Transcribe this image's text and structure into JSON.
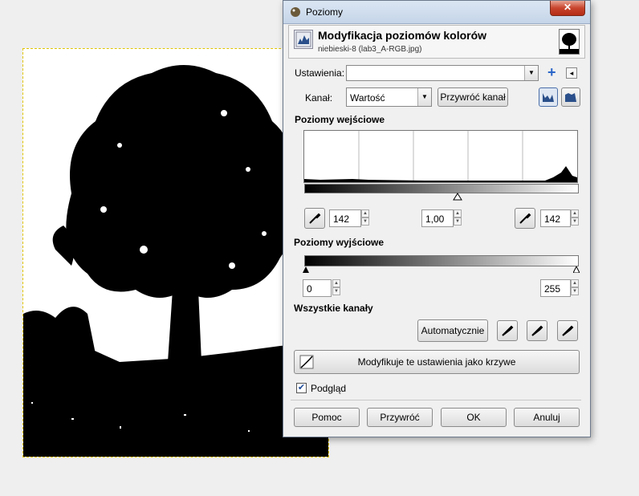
{
  "dialog": {
    "window_title": "Poziomy",
    "close_label": "✕",
    "header_title": "Modyfikacja poziomów kolorów",
    "header_subtitle": "niebieski-8 (lab3_A-RGB.jpg)"
  },
  "settings": {
    "label": "Ustawienia:",
    "value": "",
    "add_label": "+",
    "menu_label": "◂"
  },
  "channel": {
    "label": "Kanał:",
    "value": "Wartość",
    "reset_label": "Przywróć kanał"
  },
  "input_levels": {
    "title": "Poziomy wejściowe",
    "low": "142",
    "gamma": "1,00",
    "high": "142"
  },
  "output_levels": {
    "title": "Poziomy wyjściowe",
    "low": "0",
    "high": "255"
  },
  "all_channels": {
    "title": "Wszystkie kanały",
    "auto_label": "Automatycznie"
  },
  "curves_button_label": "Modyfikuje te ustawienia jako krzywe",
  "preview": {
    "label": "Podgląd",
    "checked": true
  },
  "footer": {
    "help": "Pomoc",
    "reset": "Przywróć",
    "ok": "OK",
    "cancel": "Anuluj"
  }
}
